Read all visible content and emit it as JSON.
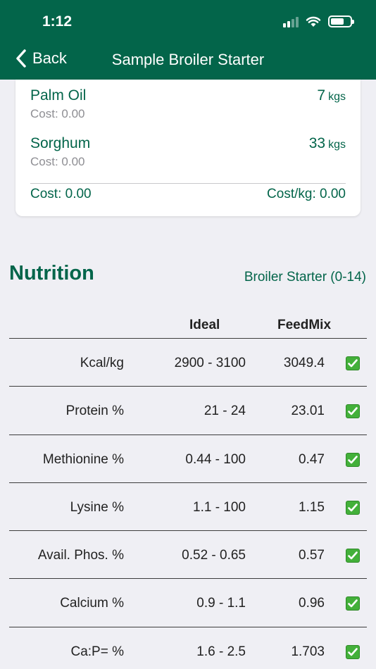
{
  "status": {
    "time": "1:12"
  },
  "nav": {
    "back_label": "Back",
    "title": "Sample Broiler Starter"
  },
  "ingredients": [
    {
      "name": "Palm Oil",
      "cost": "Cost: 0.00",
      "qty": "7",
      "unit": "kgs"
    },
    {
      "name": "Sorghum",
      "cost": "Cost: 0.00",
      "qty": "33",
      "unit": "kgs"
    }
  ],
  "totals": {
    "cost": "Cost: 0.00",
    "cost_per_kg": "Cost/kg: 0.00"
  },
  "nutrition": {
    "title": "Nutrition",
    "feed_type": "Broiler Starter (0-14)",
    "headers": {
      "ideal": "Ideal",
      "feedmix": "FeedMix"
    },
    "rows": [
      {
        "name": "Kcal/kg",
        "ideal": "2900 - 3100",
        "feedmix": "3049.4",
        "ok": true
      },
      {
        "name": "Protein %",
        "ideal": "21 - 24",
        "feedmix": "23.01",
        "ok": true
      },
      {
        "name": "Methionine %",
        "ideal": "0.44 - 100",
        "feedmix": "0.47",
        "ok": true
      },
      {
        "name": "Lysine %",
        "ideal": "1.1 - 100",
        "feedmix": "1.15",
        "ok": true
      },
      {
        "name": "Avail. Phos. %",
        "ideal": "0.52 - 0.65",
        "feedmix": "0.57",
        "ok": true
      },
      {
        "name": "Calcium %",
        "ideal": "0.9 - 1.1",
        "feedmix": "0.96",
        "ok": true
      },
      {
        "name": "Ca:P= %",
        "ideal": "1.6 - 2.5",
        "feedmix": "1.703",
        "ok": true
      }
    ]
  },
  "colors": {
    "brand": "#03654a",
    "check": "#43b03a"
  }
}
